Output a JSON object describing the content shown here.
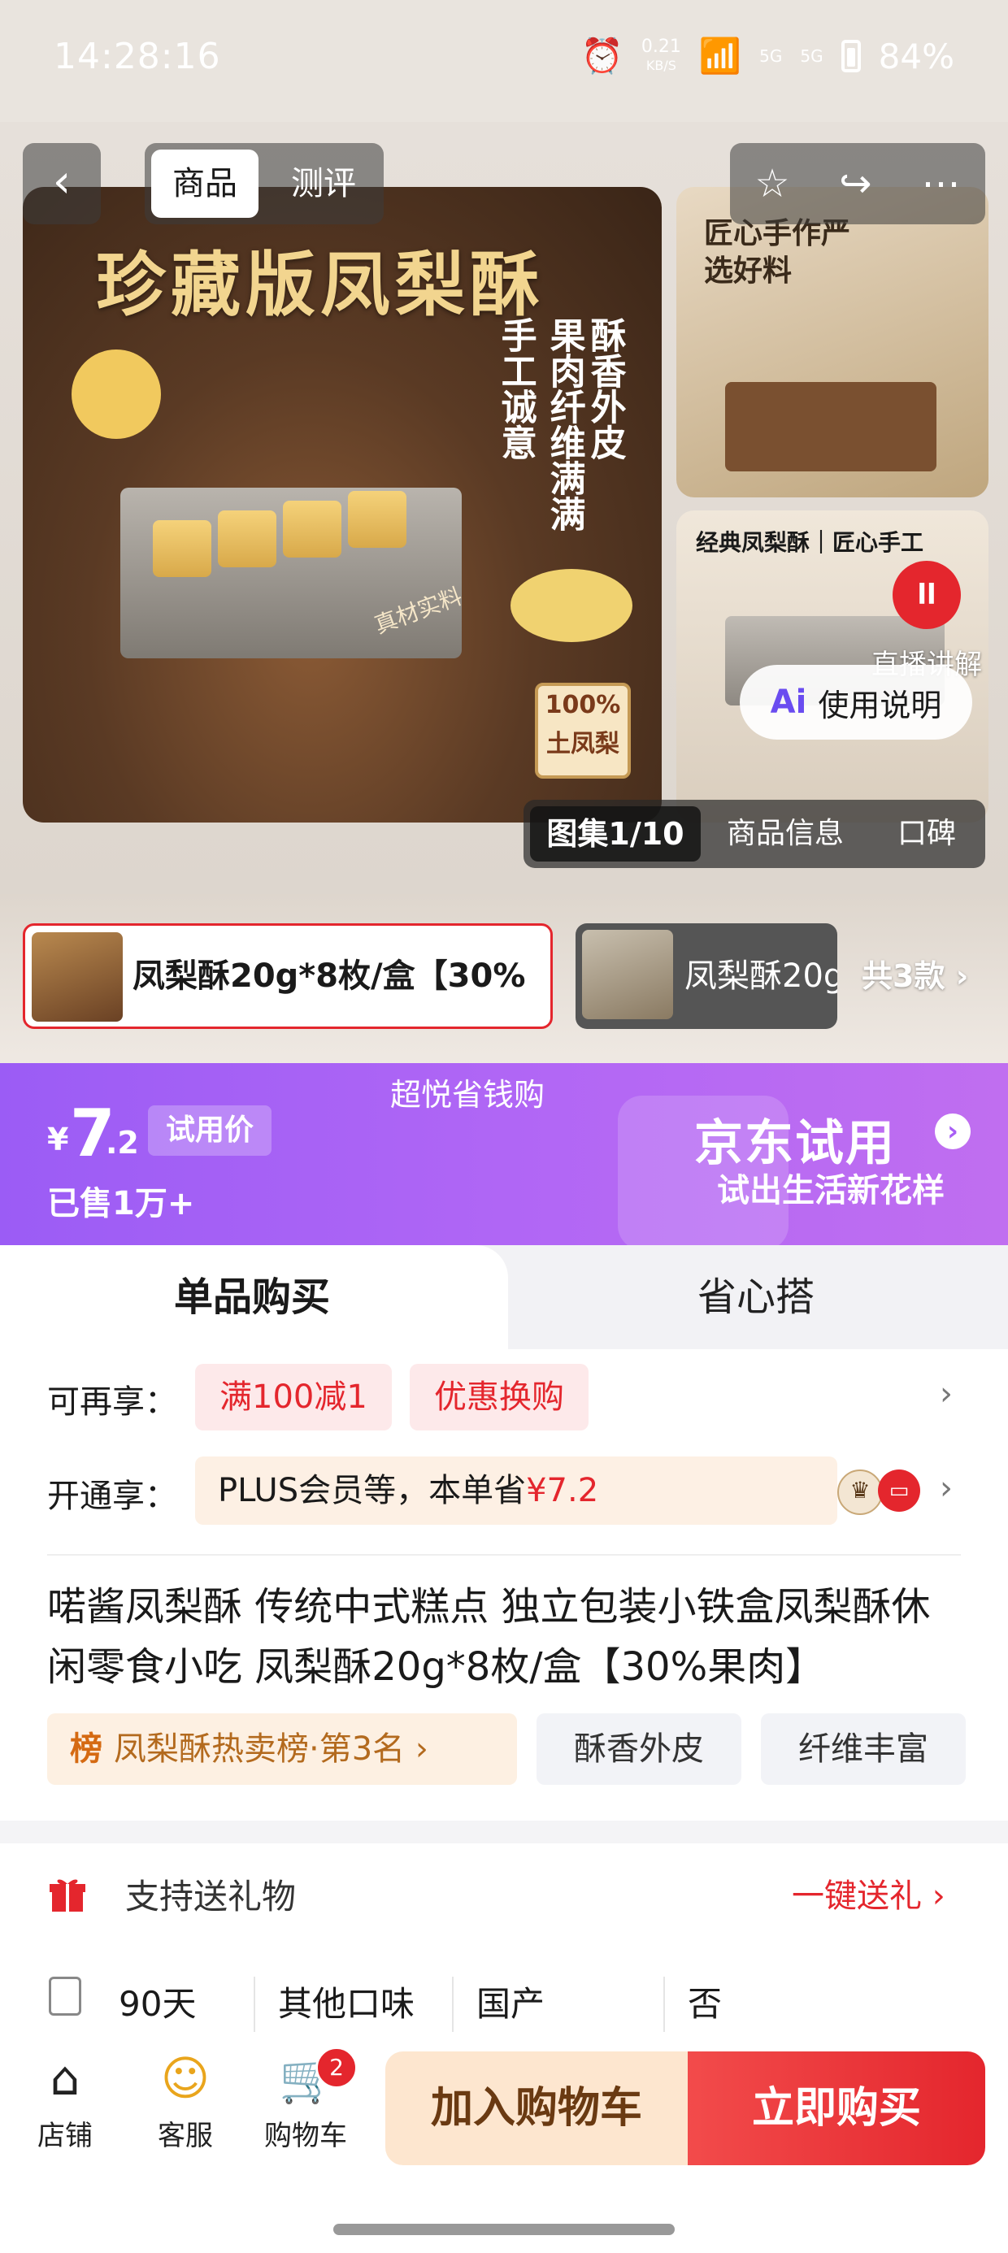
{
  "status_bar": {
    "time": "14:28:16",
    "net_speed_top": "0.21",
    "net_speed_unit": "KB/S",
    "sig1": "5G",
    "sig2": "5G",
    "battery": "84%"
  },
  "top_nav": {
    "back_icon": "chevron-left-icon",
    "tabs": [
      "商品",
      "测评"
    ],
    "actions": [
      "star-icon",
      "share-icon",
      "more-icon"
    ]
  },
  "hero": {
    "main_title": "珍藏版凤梨酥",
    "vert_col1": "酥香外皮",
    "vert_col2": "果肉纤维满满",
    "vert_col3": "手工诚意",
    "real_material": "真材实料",
    "stamp": "100%土凤梨",
    "side1_text": "匠心手作严选好料",
    "side2_text": "经典凤梨酥｜匠心手工",
    "live_label": "直播讲解",
    "ai_label": "使用说明",
    "gallery_tabs": {
      "images": "图集1/10",
      "info": "商品信息",
      "reviews": "口碑"
    }
  },
  "variants": {
    "item1": "凤梨酥20g*8枚/盒【30%",
    "item2": "凤梨酥20g",
    "count": "共3款"
  },
  "price_banner": {
    "promo": "超悦省钱购",
    "currency": "¥",
    "price_int": "7",
    "price_dec": ".2",
    "tag": "试用价",
    "sold": "已售1万+",
    "brand_main": "京东试用",
    "brand_sub": "试出生活新花样"
  },
  "purchase_mode": {
    "single": "单品购买",
    "bundle": "省心搭"
  },
  "benefits": {
    "label1": "可再享：",
    "chip1": "满100减1",
    "chip2": "优惠换购",
    "label2": "开通享：",
    "plus_text": "PLUS会员等，本单省",
    "plus_amount": "¥7.2"
  },
  "product": {
    "title": "喏酱凤梨酥 传统中式糕点 独立包装小铁盒凤梨酥休闲零食小吃 凤梨酥20g*8枚/盒【30%果肉】",
    "rank_prefix": "榜",
    "rank_text": "凤梨酥热卖榜·第3名",
    "tag1": "酥香外皮",
    "tag2": "纤维丰富"
  },
  "gift": {
    "text": "支持送礼物",
    "link": "一键送礼"
  },
  "specs": [
    "90天",
    "其他口味",
    "国产",
    "否"
  ],
  "bottom_bar": {
    "shop": "店铺",
    "service": "客服",
    "cart": "购物车",
    "cart_count": "2",
    "add_cart": "加入购物车",
    "buy_now": "立即购买"
  },
  "colors": {
    "accent_red": "#e4262d",
    "purple": "#a85ff5",
    "cart_btn": "#fde6cf"
  }
}
